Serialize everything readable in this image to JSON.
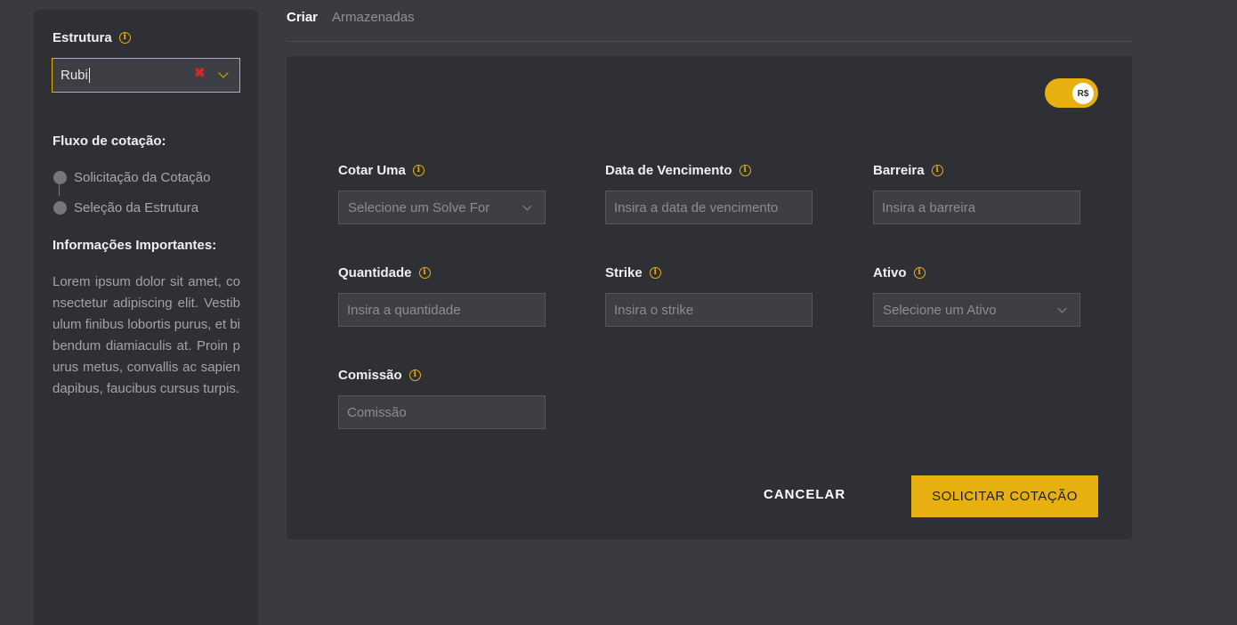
{
  "sidebar": {
    "structure_label": "Estrutura",
    "structure_value": "Rubi",
    "clear_symbol": "✖",
    "flow_title": "Fluxo de cotação:",
    "steps": [
      {
        "label": "Solicitação da Cotação"
      },
      {
        "label": "Seleção da Estrutura"
      }
    ],
    "important_title": "Informações Importantes:",
    "important_text": "Lorem ipsum dolor sit amet, consectetur adipiscing elit. Vestibulum finibus lobortis purus, et bibendum diamiaculis at. Proin purus metus, convallis ac sapien dapibus, faucibus cursus turpis."
  },
  "tabs": [
    {
      "label": "Criar",
      "active": true
    },
    {
      "label": "Armazenadas",
      "active": false
    }
  ],
  "currency_toggle": {
    "label": "R$",
    "on": true
  },
  "form": {
    "cotar_uma": {
      "label": "Cotar Uma",
      "placeholder": "Selecione um Solve For"
    },
    "data_vencimento": {
      "label": "Data de Vencimento",
      "placeholder": "Insira a data de vencimento"
    },
    "barreira": {
      "label": "Barreira",
      "placeholder": "Insira a barreira"
    },
    "quantidade": {
      "label": "Quantidade",
      "placeholder": "Insira a quantidade"
    },
    "strike": {
      "label": "Strike",
      "placeholder": "Insira o strike"
    },
    "ativo": {
      "label": "Ativo",
      "placeholder": "Selecione um Ativo"
    },
    "comissao": {
      "label": "Comissão",
      "placeholder": "Comissão"
    }
  },
  "actions": {
    "cancel_label": "CANCELAR",
    "submit_label": "SOLICITAR COTAÇÃO"
  },
  "colors": {
    "accent": "#e8b00e",
    "background": "#3a3b40",
    "panel": "#2f3035",
    "clear": "#e02424"
  }
}
